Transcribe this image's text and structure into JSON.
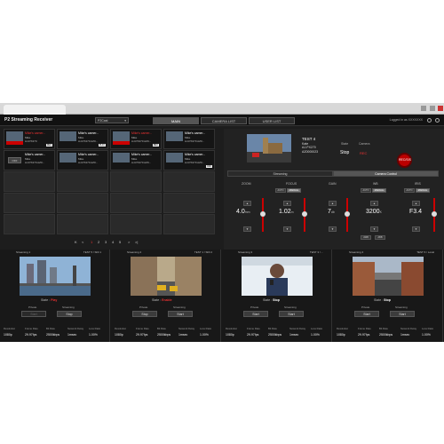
{
  "app": {
    "title": "P2 Streaming Receiver",
    "dropdown_value": "P2Cast",
    "nav_tabs": [
      "MAIN",
      "CAMERA LIST",
      "USER LIST"
    ],
    "active_tab": "MAIN",
    "login_text": "Logged in as XXXXXXX"
  },
  "camera_list": {
    "cells": [
      {
        "kind": "live",
        "name": "Mike's camer...",
        "user": "Mike",
        "model": "AJ-PX270",
        "id": "AZ0...",
        "state": "REC"
      },
      {
        "kind": "live",
        "name": "Mike's camer...",
        "user": "Mike",
        "model": "AJ-PX270 AZ0...",
        "id": "",
        "state": "PLAY"
      },
      {
        "kind": "live",
        "name": "Mike's camer...",
        "user": "Mike",
        "model": "AJ-PX270 AZ0...",
        "id": "",
        "state": "REC"
      },
      {
        "kind": "live",
        "name": "Mike's camer...",
        "user": "Mike",
        "model": "AJ-PX270 AZ0...",
        "id": "",
        "state": ""
      },
      {
        "kind": "off",
        "name": "Mike's camer...",
        "user": "Mike",
        "model": "AJ-PX270 AZ0...",
        "id": "",
        "state": "OFF"
      },
      {
        "kind": "live",
        "name": "Mike's camer...",
        "user": "Mike",
        "model": "AJ-PX270 AZ0...",
        "id": "",
        "state": ""
      },
      {
        "kind": "live",
        "name": "Mike's camer...",
        "user": "Mike",
        "model": "AJ-PX270 AZ0...",
        "id": "",
        "state": ""
      },
      {
        "kind": "live",
        "name": "Mike's camer...",
        "user": "Mike",
        "model": "AJ-PX270 AZ0...",
        "id": "",
        "state": "OFF"
      }
    ],
    "pager": {
      "first": "K",
      "prev": "<",
      "pages": [
        "1",
        "2",
        "3",
        "4",
        "5"
      ],
      "current": "1",
      "next": ">",
      "last": ">|"
    }
  },
  "camera_detail": {
    "name": "TEST 4",
    "user": "Kate",
    "model": "AJ-PX270",
    "id": "AZ0000023",
    "state_label": "State",
    "state_value": "Stop",
    "camera_label": "Camera",
    "camera_value": "REC",
    "rec_button": "REC/S/S",
    "tabs": [
      "Streaming",
      "Camera Control"
    ],
    "active_tab": "Camera Control",
    "controls": {
      "zoom_label": "ZOOM",
      "focus_label": "FOCUS",
      "gain_label": "GAIN",
      "wb_label": "WB",
      "iris_label": "IRIS",
      "auto": "AUTO",
      "manual": "MANUAL",
      "zoom_value": "4.0",
      "zoom_unit": "mm",
      "focus_value": "1.02",
      "focus_unit": "m",
      "gain_value": "7",
      "gain_unit": "db",
      "wb_value": "3200",
      "wb_unit": "K",
      "iris_value": "F3.4",
      "awb": "AWB",
      "abb": "ABB",
      "up": "▲",
      "down": "▼"
    }
  },
  "streams": [
    {
      "title": "Streaming 1",
      "src": "TEST 5 / SDI 1",
      "state_label": "State :",
      "state": "Play",
      "state_color": "#e03030",
      "col1_label": "Private",
      "col2_label": "Streaming",
      "btn1": "Start",
      "btn2": "Stop",
      "btn1_disabled": true
    },
    {
      "title": "Streaming 2",
      "src": "TEST 1 / SDI 2",
      "state_label": "State :",
      "state": "Enable",
      "state_color": "#e03030",
      "col1_label": "Private",
      "col2_label": "Streaming",
      "btn1": "Stop",
      "btn2": "Start",
      "btn1_disabled": false
    },
    {
      "title": "Streaming 3",
      "src": "TEST 3 / ...",
      "state_label": "State :",
      "state": "Stop",
      "state_color": "#ffffff",
      "col1_label": "Private",
      "col2_label": "Streaming",
      "btn1": "Start",
      "btn2": "Start",
      "btn1_disabled": false
    },
    {
      "title": "Streaming 4",
      "src": "TEST 6 / Local",
      "state_label": "State :",
      "state": "Stop",
      "state_color": "#ffffff",
      "col1_label": "Private",
      "col2_label": "Streaming",
      "btn1": "Start",
      "btn2": "Start",
      "btn1_disabled": false
    }
  ],
  "stats": {
    "labels": [
      "Resolution",
      "Frame Rate",
      "Bit Rate",
      "Network Delay",
      "Loss Ratio"
    ],
    "values": [
      "1080p",
      "29.97fps",
      "2500kbps",
      "1msec",
      "1.00%"
    ]
  }
}
